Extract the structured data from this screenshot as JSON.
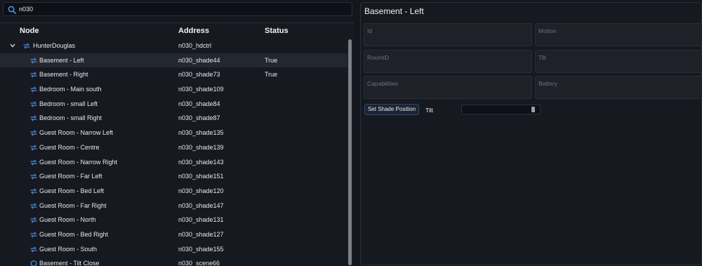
{
  "search": {
    "value": "n030",
    "icon": "search-icon"
  },
  "tree": {
    "columns": [
      "Node",
      "Address",
      "Status"
    ],
    "rows": [
      {
        "name": "HunterDouglas",
        "address": "n030_hdctrl",
        "status": "",
        "level": 0,
        "icon": "link-arrows-icon"
      },
      {
        "name": "Basement - Left",
        "address": "n030_shade44",
        "status": "True",
        "level": 1,
        "icon": "link-arrows-icon"
      },
      {
        "name": "Basement - Right",
        "address": "n030_shade73",
        "status": "True",
        "level": 1,
        "icon": "link-arrows-icon"
      },
      {
        "name": "Bedroom - Main south",
        "address": "n030_shade109",
        "status": "",
        "level": 1,
        "icon": "link-arrows-icon"
      },
      {
        "name": "Bedroom - small Left",
        "address": "n030_shade84",
        "status": "",
        "level": 1,
        "icon": "link-arrows-icon"
      },
      {
        "name": "Bedroom - small Right",
        "address": "n030_shade87",
        "status": "",
        "level": 1,
        "icon": "link-arrows-icon"
      },
      {
        "name": "Guest Room - Narrow Left",
        "address": "n030_shade135",
        "status": "",
        "level": 1,
        "icon": "link-arrows-icon"
      },
      {
        "name": "Guest Room - Centre",
        "address": "n030_shade139",
        "status": "",
        "level": 1,
        "icon": "link-arrows-icon"
      },
      {
        "name": "Guest Room - Narrow Right",
        "address": "n030_shade143",
        "status": "",
        "level": 1,
        "icon": "link-arrows-icon"
      },
      {
        "name": "Guest Room - Far Left",
        "address": "n030_shade151",
        "status": "",
        "level": 1,
        "icon": "link-arrows-icon"
      },
      {
        "name": "Guest Room - Bed Left",
        "address": "n030_shade120",
        "status": "",
        "level": 1,
        "icon": "link-arrows-icon"
      },
      {
        "name": "Guest Room - Far Right",
        "address": "n030_shade147",
        "status": "",
        "level": 1,
        "icon": "link-arrows-icon"
      },
      {
        "name": "Guest Room - North",
        "address": "n030_shade131",
        "status": "",
        "level": 1,
        "icon": "link-arrows-icon"
      },
      {
        "name": "Guest Room - Bed Right",
        "address": "n030_shade127",
        "status": "",
        "level": 1,
        "icon": "link-arrows-icon"
      },
      {
        "name": "Guest Room - South",
        "address": "n030_shade155",
        "status": "",
        "level": 1,
        "icon": "link-arrows-icon"
      },
      {
        "name": "Basement - Tilt Close",
        "address": "n030_scene66",
        "status": "",
        "level": 1,
        "icon": "scene-icon"
      }
    ]
  },
  "detail": {
    "title": "Basement - Left",
    "fields": [
      "Id",
      "Motion",
      "RoomID",
      "Tilt",
      "Capabilities",
      "Battery"
    ],
    "set_button": "Set Shade Position",
    "tilt_label": "Tilt",
    "tilt_value": ""
  },
  "colors": {
    "background": "#14171e",
    "panel": "#161920",
    "field": "#1e2128",
    "accent": "#4a8ee0",
    "selected_row": "#23272f"
  }
}
